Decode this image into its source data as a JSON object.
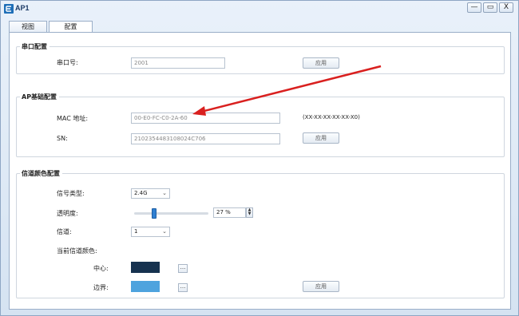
{
  "window": {
    "title": "AP1",
    "minimize_icon": "—",
    "maximize_icon": "▭",
    "close_icon": "X"
  },
  "tabs": [
    {
      "label": "视图"
    },
    {
      "label": "配置"
    }
  ],
  "serial_config": {
    "title": "串口配置",
    "port_label": "串口号:",
    "port_value": "2001",
    "apply_label": "应用"
  },
  "ap_basic_config": {
    "title": "AP基础配置",
    "mac_label": "MAC 地址:",
    "mac_value": "00-E0-FC-C0-2A-60",
    "mac_hint": "(XX-XX-XX-XX-XX-X0)",
    "sn_label": "SN:",
    "sn_value": "2102354483108024C706",
    "apply_label": "应用"
  },
  "channel_color_config": {
    "title": "信道颜色配置",
    "signal_type_label": "信号类型:",
    "signal_type_value": "2.4G",
    "transparency_label": "透明度:",
    "transparency_value": "27 %",
    "transparency_percent": 27,
    "channel_label": "信道:",
    "channel_value": "1",
    "current_color_label": "当前信道颜色:",
    "center_label": "中心:",
    "center_color": "#16324f",
    "border_label": "边界:",
    "border_color": "#4ea3de",
    "dots_label": "...",
    "apply_label": "应用"
  },
  "colors": {
    "annotation_arrow": "#d9201f",
    "accent": "#2f7fd1"
  }
}
